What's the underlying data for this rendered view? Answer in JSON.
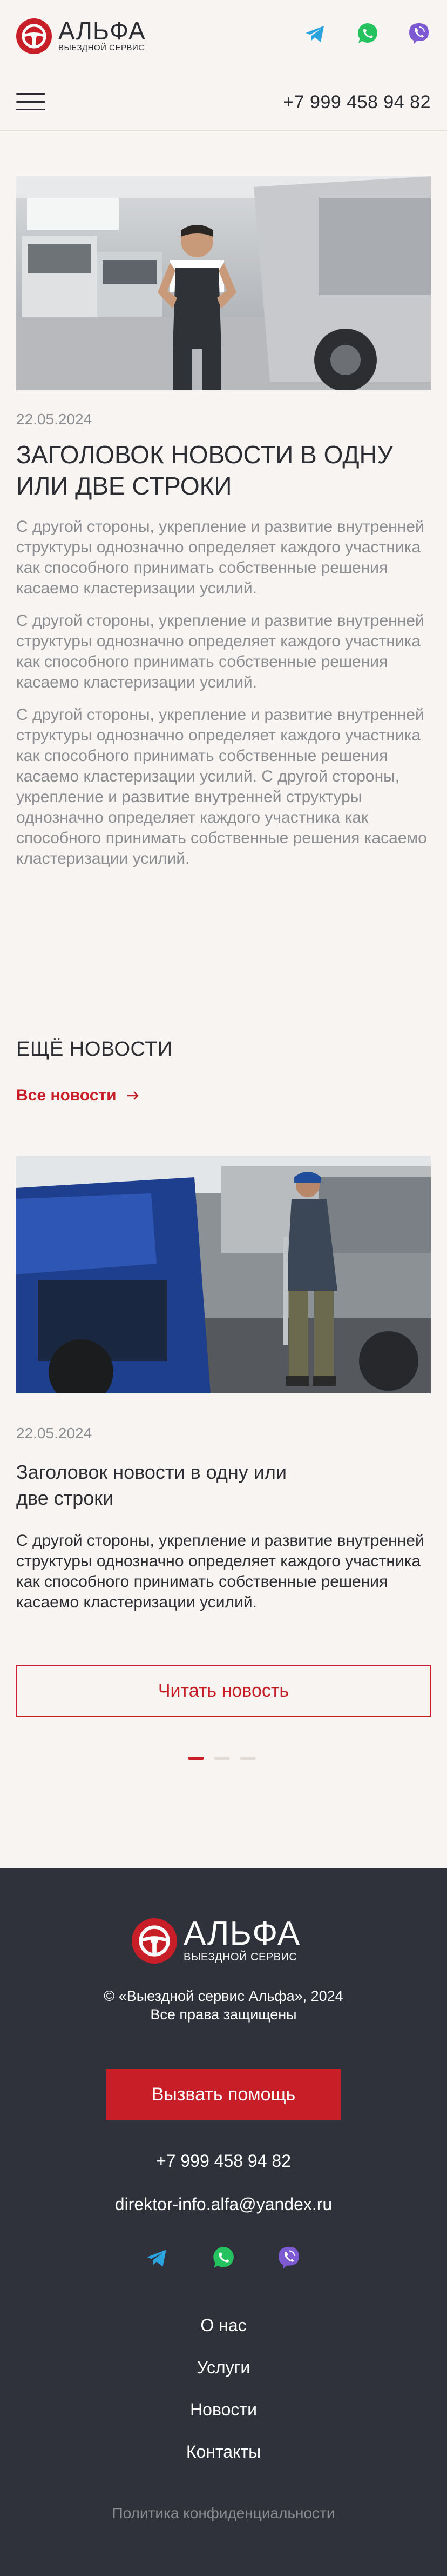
{
  "brand": {
    "name": "АЛЬФА",
    "subtitle": "ВЫЕЗДНОЙ СЕРВИС"
  },
  "header": {
    "phone": "+7 999 458 94 82",
    "socials": [
      "telegram-icon",
      "whatsapp-icon",
      "viber-icon"
    ]
  },
  "article": {
    "date": "22.05.2024",
    "title": "ЗАГОЛОВОК НОВОСТИ В ОДНУ ИЛИ ДВЕ СТРОКИ",
    "paragraphs": [
      "С другой стороны, укрепление и развитие внутренней структуры однозначно определяет каждого участника как способного принимать собственные решения касаемо кластеризации усилий.",
      "С другой стороны, укрепление и развитие внутренней структуры однозначно определяет каждого участника как способного принимать собственные решения касаемо кластеризации усилий.",
      "С другой стороны, укрепление и развитие внутренней структуры однозначно определяет каждого участника как способного принимать собственные решения касаемо кластеризации усилий. С другой стороны, укрепление и развитие внутренней структуры однозначно определяет каждого участника как способного принимать собственные решения касаемо кластеризации усилий."
    ]
  },
  "more_news": {
    "title": "ЕЩЁ НОВОСТИ",
    "all_link": "Все новости",
    "card": {
      "date": "22.05.2024",
      "title": "Заголовок новости в одну или две строки",
      "text": "С другой стороны, укрепление и развитие внутренней структуры однозначно определяет каждого участника как способного принимать собственные решения касаемо кластеризации усилий.",
      "button": "Читать новость"
    },
    "pagination": {
      "count": 3,
      "active": 1
    }
  },
  "footer": {
    "copyright_line1": "© «Выездной сервис Альфа», 2024",
    "copyright_line2": "Все права защищены",
    "cta": "Вызвать помощь",
    "phone": "+7 999 458 94 82",
    "email": "direktor-info.alfa@yandex.ru",
    "nav": [
      "О нас",
      "Услуги",
      "Новости",
      "Контакты"
    ],
    "privacy": "Политика конфиденциальности"
  },
  "colors": {
    "accent": "#c81e28",
    "background": "#f7f4f1",
    "footer": "#2f323a",
    "muted_text": "#8b8d91",
    "telegram": "#2aa3df",
    "whatsapp": "#25c260",
    "viber": "#7d59d2"
  }
}
